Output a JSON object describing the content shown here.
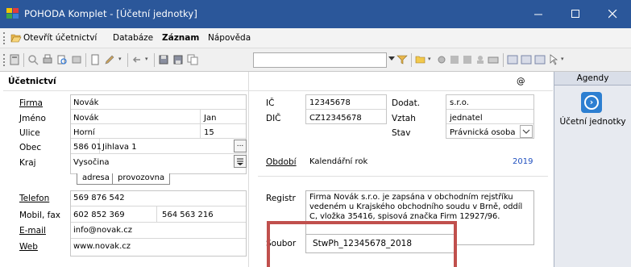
{
  "window": {
    "title": "POHODA Komplet - [Účetní jednotky]",
    "controls": {
      "minimize": "—",
      "maximize": "☐",
      "close": "✕"
    },
    "accent": "#2b579a"
  },
  "menu": {
    "items": [
      "Otevřít účetnictví",
      "Databáze",
      "Záznam",
      "Nápověda"
    ]
  },
  "toolbar": {
    "combo_value": ""
  },
  "form": {
    "section_title": "Účetnictví",
    "at_symbol": "@",
    "labels": {
      "firma": "Firma",
      "jmeno": "Jméno",
      "ulice": "Ulice",
      "obec": "Obec",
      "kraj": "Kraj",
      "telefon": "Telefon",
      "mobil_fax": "Mobil, fax",
      "email": "E-mail",
      "web": "Web",
      "ic": "IČ",
      "dic": "DIČ",
      "dodat": "Dodat.",
      "vztah": "Vztah",
      "stav": "Stav",
      "obdobi": "Období",
      "registr": "Registr",
      "soubor": "Soubor"
    },
    "values": {
      "firma": "Novák",
      "jmeno": "Novák",
      "jmeno2": "Jan",
      "ulice": "Horní",
      "cislo": "15",
      "psc": "586 01",
      "obec": "Jihlava 1",
      "kraj": "Vysočina",
      "telefon": "569 876 542",
      "mobil": "602 852 369",
      "fax": "564 563 216",
      "email": "info@novak.cz",
      "web": "www.novak.cz",
      "ic": "12345678",
      "dic": "CZ12345678",
      "dodat": "s.r.o.",
      "vztah": "jednatel",
      "stav": "Právnická osoba",
      "obdobi": "Kalendářní rok",
      "rok": "2019",
      "registr": "Firma Novák s.r.o. je zapsána v obchodním rejstříku vedeném u Krajského obchodního soudu v Brně, oddíl C, vložka 35416, spisová značka Firm 12927/96.",
      "soubor": "StwPh_12345678_2018"
    },
    "tabs": [
      "adresa",
      "provozovna"
    ],
    "ellipsis": "...",
    "highlight_color": "#c0504d"
  },
  "agendy": {
    "header": "Agendy",
    "item_label": "Účetní jednotky"
  }
}
